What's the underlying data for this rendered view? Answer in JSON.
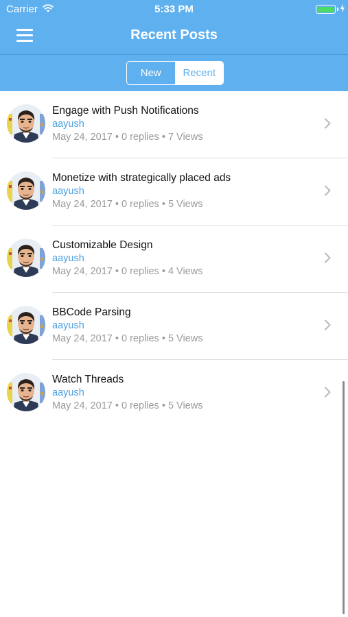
{
  "status_bar": {
    "carrier": "Carrier",
    "time": "5:33 PM",
    "battery_color": "#4cd964"
  },
  "nav": {
    "title": "Recent Posts",
    "menu_icon": "hamburger-menu-icon"
  },
  "segmented_control": {
    "options": [
      "New",
      "Recent"
    ],
    "selected": "Recent"
  },
  "colors": {
    "header_bg": "#5fb0ef",
    "author": "#4a9fe0",
    "meta": "#9a9a9a"
  },
  "posts": [
    {
      "title": "Engage with Push Notifications",
      "author": "aayush",
      "meta": "May 24, 2017 • 0 replies • 7 Views"
    },
    {
      "title": "Monetize with strategically placed ads",
      "author": "aayush",
      "meta": "May 24, 2017 • 0 replies • 5 Views"
    },
    {
      "title": "Customizable Design",
      "author": "aayush",
      "meta": "May 24, 2017 • 0 replies • 4 Views"
    },
    {
      "title": "BBCode Parsing",
      "author": "aayush",
      "meta": "May 24, 2017 • 0 replies • 5 Views"
    },
    {
      "title": "Watch Threads",
      "author": "aayush",
      "meta": "May 24, 2017 • 0 replies • 5 Views"
    }
  ]
}
